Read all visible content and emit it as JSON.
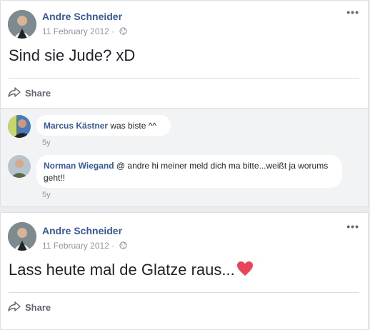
{
  "posts": [
    {
      "author": "Andre Schneider",
      "date": "11 February 2012 ·",
      "text": "Sind sie Jude? xD",
      "more": "•••",
      "share_label": "Share",
      "comments": [
        {
          "name": "Marcus Kästner",
          "text": " was biste ^^",
          "time": "5y"
        },
        {
          "name": "Norman Wiegand",
          "text": " @ andre hi meiner meld dich ma bitte...weißt ja worums geht!!",
          "time": "5y"
        }
      ]
    },
    {
      "author": "Andre Schneider",
      "date": "11 February 2012 ·",
      "text": "Lass heute mal de Glatze raus...",
      "more": "•••",
      "share_label": "Share"
    }
  ],
  "icons": {
    "privacy": "globe-icon",
    "share": "share-arrow-icon",
    "emoji": "heart-emoji-icon"
  },
  "colors": {
    "link": "#385898",
    "muted": "#90949c",
    "heart": "#e94359"
  }
}
